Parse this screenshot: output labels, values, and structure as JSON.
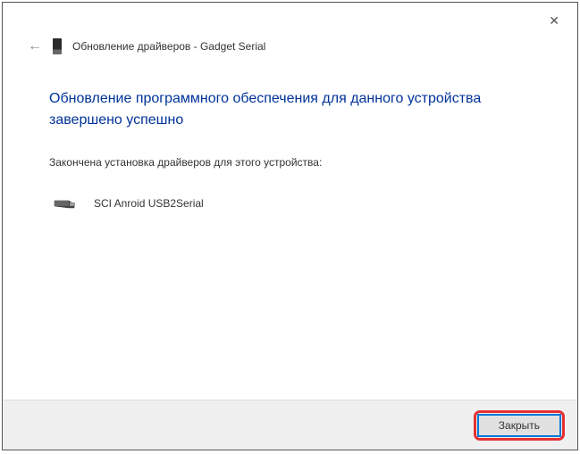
{
  "window": {
    "title_prefix": "Обновление драйверов",
    "title_device": "Gadget Serial",
    "full_title": "Обновление драйверов - Gadget Serial"
  },
  "content": {
    "heading": "Обновление программного обеспечения для данного устройства завершено успешно",
    "subtext": "Закончена установка драйверов для этого устройства:",
    "device_name": "SCI Anroid USB2Serial"
  },
  "buttons": {
    "close": "Закрыть"
  }
}
